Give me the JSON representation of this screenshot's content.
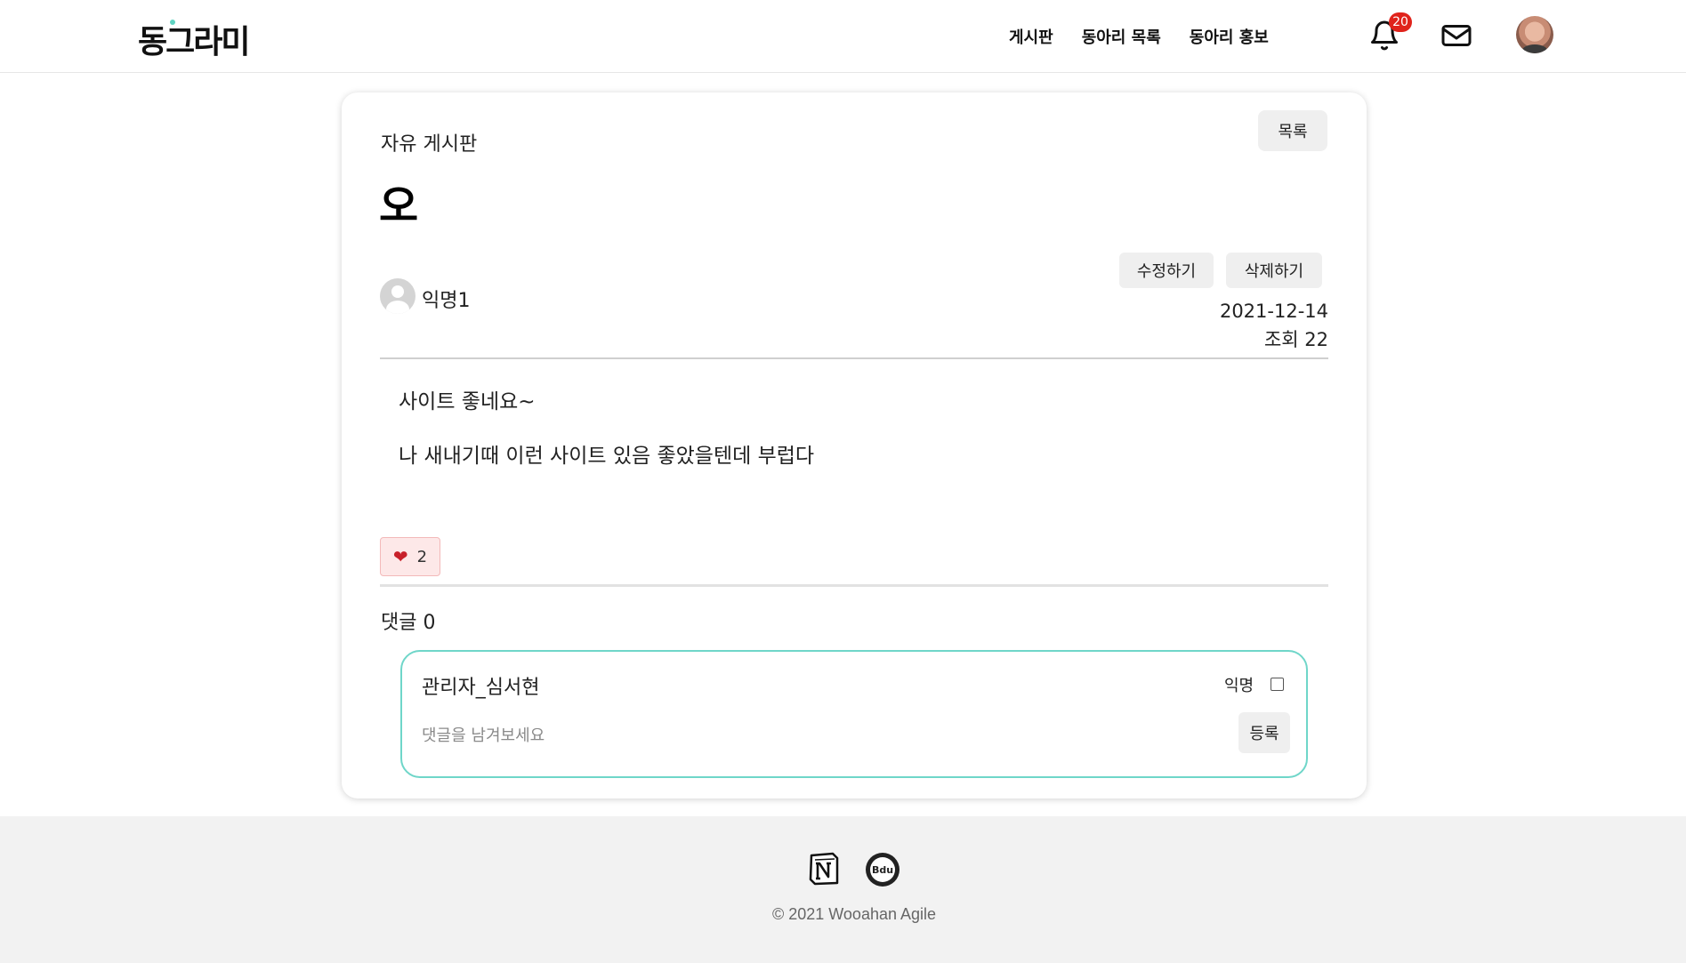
{
  "header": {
    "logo": "동그라미",
    "nav": [
      "게시판",
      "동아리 목록",
      "동아리 홍보"
    ],
    "notification_count": "20",
    "icons": [
      "bell-icon",
      "mail-icon",
      "avatar"
    ]
  },
  "post": {
    "board_name": "자유 게시판",
    "list_button": "목록",
    "title": "오",
    "edit_button": "수정하기",
    "delete_button": "삭제하기",
    "author": "익명1",
    "date": "2021-12-14",
    "views": "조회 22",
    "body": [
      "사이트 좋네요~",
      "나 새내기때 이런 사이트 있음 좋았을텐데 부럽다"
    ],
    "like_count": "2"
  },
  "comments": {
    "count_label": "댓글 0",
    "commenter": "관리자_심서현",
    "anonymous_label": "익명",
    "anonymous_checked": false,
    "input_placeholder": "댓글을 남겨보세요",
    "submit_button": "등록"
  },
  "footer": {
    "copyright": "© 2021 Wooahan Agile"
  },
  "colors": {
    "accent": "#6fd6c9",
    "badge": "#e0231b",
    "heart": "#c8202a"
  }
}
